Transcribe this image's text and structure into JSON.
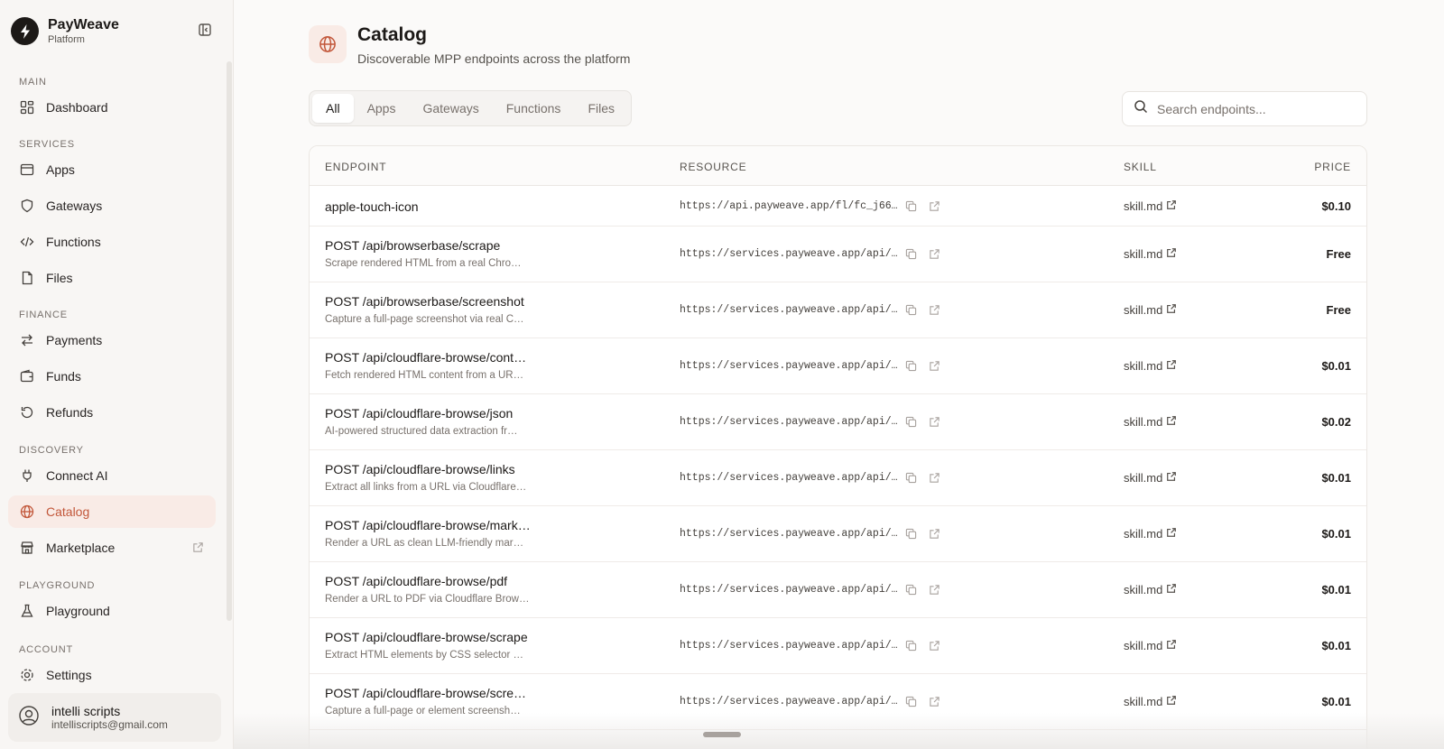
{
  "brand": {
    "name": "PayWeave",
    "subtitle": "Platform"
  },
  "nav": {
    "sections": [
      {
        "label": "MAIN",
        "items": [
          {
            "label": "Dashboard",
            "icon": "dashboard-icon"
          }
        ]
      },
      {
        "label": "SERVICES",
        "items": [
          {
            "label": "Apps",
            "icon": "window-icon"
          },
          {
            "label": "Gateways",
            "icon": "shield-icon"
          },
          {
            "label": "Functions",
            "icon": "code-icon"
          },
          {
            "label": "Files",
            "icon": "file-icon"
          }
        ]
      },
      {
        "label": "FINANCE",
        "items": [
          {
            "label": "Payments",
            "icon": "arrows-icon"
          },
          {
            "label": "Funds",
            "icon": "wallet-icon"
          },
          {
            "label": "Refunds",
            "icon": "refresh-icon"
          }
        ]
      },
      {
        "label": "DISCOVERY",
        "items": [
          {
            "label": "Connect AI",
            "icon": "plug-icon"
          },
          {
            "label": "Catalog",
            "icon": "globe-icon",
            "active": true
          },
          {
            "label": "Marketplace",
            "icon": "store-icon",
            "external": true
          }
        ]
      },
      {
        "label": "PLAYGROUND",
        "items": [
          {
            "label": "Playground",
            "icon": "flask-icon"
          }
        ]
      },
      {
        "label": "ACCOUNT",
        "items": [
          {
            "label": "Settings",
            "icon": "gear-icon"
          }
        ]
      }
    ]
  },
  "user": {
    "name": "intelli scripts",
    "email": "intelliscripts@gmail.com"
  },
  "page": {
    "title": "Catalog",
    "subtitle": "Discoverable MPP endpoints across the platform"
  },
  "tabs": [
    "All",
    "Apps",
    "Gateways",
    "Functions",
    "Files"
  ],
  "active_tab": "All",
  "search": {
    "placeholder": "Search endpoints..."
  },
  "table": {
    "headers": {
      "endpoint": "ENDPOINT",
      "resource": "RESOURCE",
      "skill": "SKILL",
      "price": "PRICE"
    },
    "rows": [
      {
        "name": "apple-touch-icon",
        "desc": "",
        "resource": "https://api.payweave.app/fl/fc_j66…",
        "skill": "skill.md",
        "price": "$0.10"
      },
      {
        "name": "POST /api/browserbase/scrape",
        "desc": "Scrape rendered HTML from a real Chro…",
        "resource": "https://services.payweave.app/api/…",
        "skill": "skill.md",
        "price": "Free"
      },
      {
        "name": "POST /api/browserbase/screenshot",
        "desc": "Capture a full-page screenshot via real C…",
        "resource": "https://services.payweave.app/api/…",
        "skill": "skill.md",
        "price": "Free"
      },
      {
        "name": "POST /api/cloudflare-browse/cont…",
        "desc": "Fetch rendered HTML content from a UR…",
        "resource": "https://services.payweave.app/api/…",
        "skill": "skill.md",
        "price": "$0.01"
      },
      {
        "name": "POST /api/cloudflare-browse/json",
        "desc": "AI-powered structured data extraction fr…",
        "resource": "https://services.payweave.app/api/…",
        "skill": "skill.md",
        "price": "$0.02"
      },
      {
        "name": "POST /api/cloudflare-browse/links",
        "desc": "Extract all links from a URL via Cloudflare…",
        "resource": "https://services.payweave.app/api/…",
        "skill": "skill.md",
        "price": "$0.01"
      },
      {
        "name": "POST /api/cloudflare-browse/mark…",
        "desc": "Render a URL as clean LLM-friendly mar…",
        "resource": "https://services.payweave.app/api/…",
        "skill": "skill.md",
        "price": "$0.01"
      },
      {
        "name": "POST /api/cloudflare-browse/pdf",
        "desc": "Render a URL to PDF via Cloudflare Brow…",
        "resource": "https://services.payweave.app/api/…",
        "skill": "skill.md",
        "price": "$0.01"
      },
      {
        "name": "POST /api/cloudflare-browse/scrape",
        "desc": "Extract HTML elements by CSS selector …",
        "resource": "https://services.payweave.app/api/…",
        "skill": "skill.md",
        "price": "$0.01"
      },
      {
        "name": "POST /api/cloudflare-browse/scre…",
        "desc": "Capture a full-page or element screensh…",
        "resource": "https://services.payweave.app/api/…",
        "skill": "skill.md",
        "price": "$0.01"
      }
    ]
  },
  "colors": {
    "accent": "#c2573a",
    "accent_bg": "#f9ebe6"
  }
}
